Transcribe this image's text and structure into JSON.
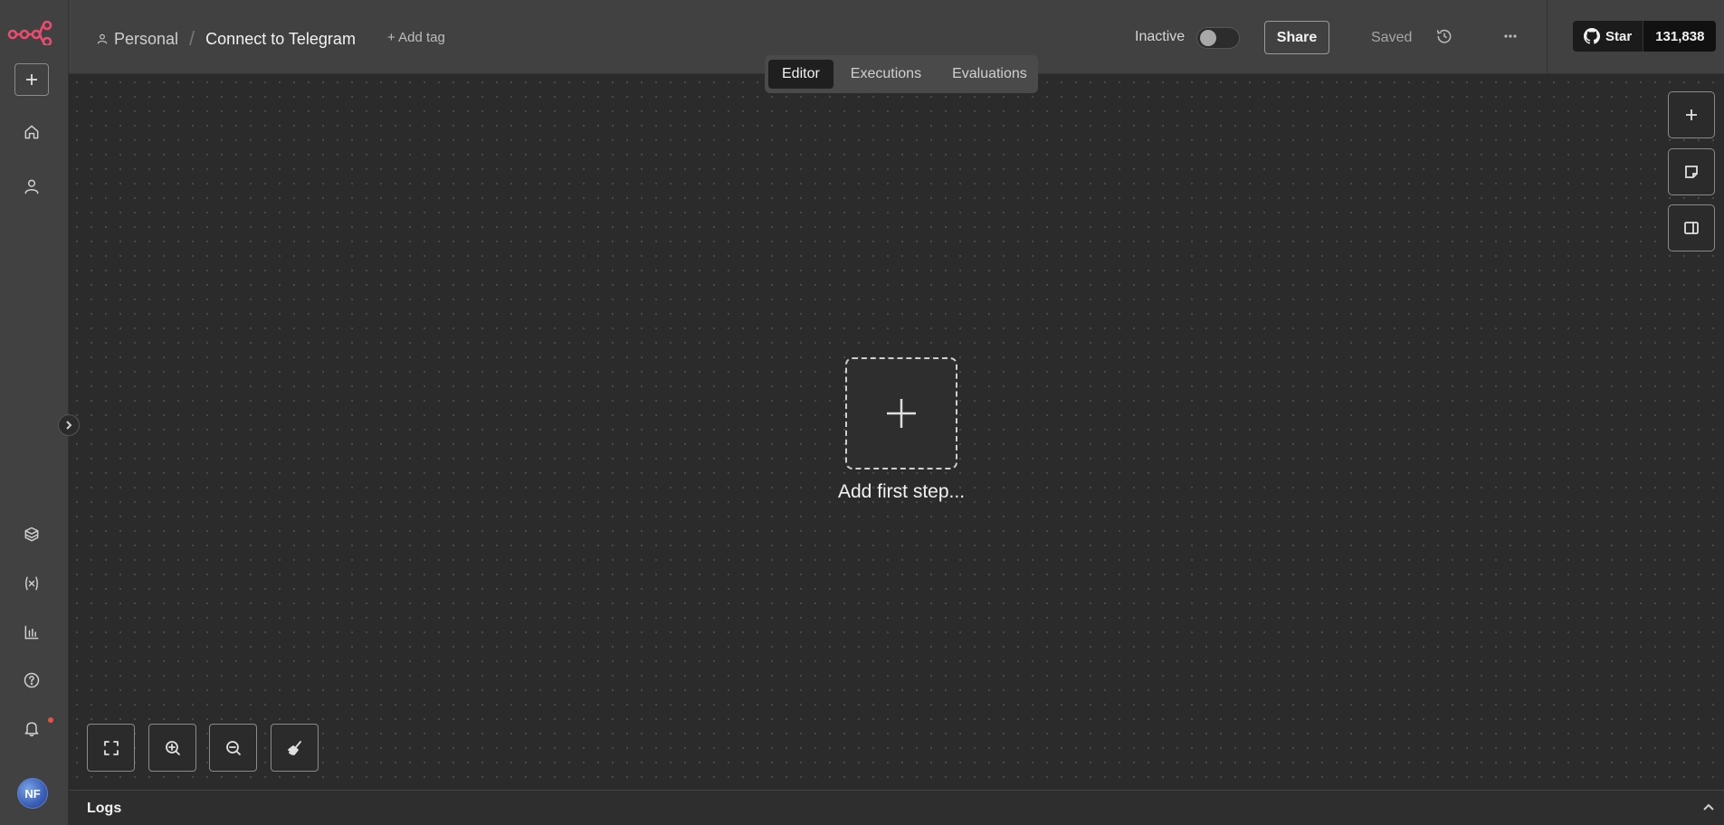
{
  "sidebar": {
    "new_label": "+",
    "avatar_initials": "NF"
  },
  "header": {
    "breadcrumb": {
      "project": "Personal",
      "separator": "/",
      "workflow_title": "Connect to Telegram"
    },
    "add_tag_label": "+ Add tag",
    "active_label": "Inactive",
    "share_label": "Share",
    "saved_label": "Saved",
    "github": {
      "star_label": "Star",
      "star_count": "131,838"
    }
  },
  "tabs": [
    {
      "label": "Editor",
      "active": true
    },
    {
      "label": "Executions",
      "active": false
    },
    {
      "label": "Evaluations",
      "active": false
    }
  ],
  "canvas": {
    "add_first_step_label": "Add first step..."
  },
  "logs": {
    "label": "Logs"
  },
  "colors": {
    "accent": "#ea4b71",
    "background": "#2b2b2b",
    "panel": "#414141",
    "notification_dot": "#e5524a"
  }
}
